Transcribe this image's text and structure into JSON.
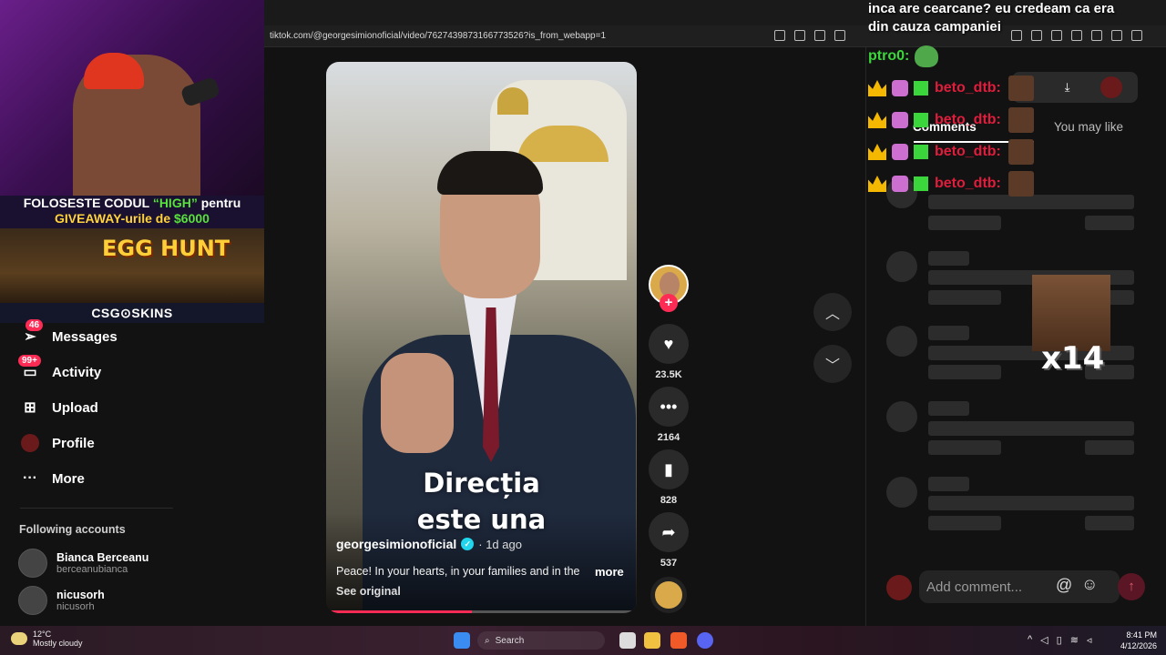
{
  "browser": {
    "url": "tiktok.com/@georgesimionoficial/video/7627439873166773526?is_from_webapp=1"
  },
  "stream_overlay": {
    "promo_line1_prefix": "FOLOSESTE CODUL ",
    "promo_code": "“HIGH”",
    "promo_line1_suffix": " pentru",
    "promo_line2_prefix": "GIVEAWAY-urile de ",
    "promo_amount": "$6000",
    "banner_title": "EGG HUNT",
    "sponsor": "CSG⊙SKINS"
  },
  "nav": {
    "items": [
      {
        "label": "Messages",
        "badge": "46",
        "icon": "paper-plane-icon"
      },
      {
        "label": "Activity",
        "badge": "99+",
        "icon": "message-icon"
      },
      {
        "label": "Upload",
        "badge": "",
        "icon": "plus-square-icon"
      },
      {
        "label": "Profile",
        "badge": "",
        "icon": "avatar-icon"
      },
      {
        "label": "More",
        "badge": "",
        "icon": "ellipsis-icon"
      }
    ],
    "following_title": "Following accounts",
    "following": [
      {
        "name": "Bianca Berceanu",
        "handle": "berceanubianca"
      },
      {
        "name": "nicusorh",
        "handle": "nicusorh"
      }
    ]
  },
  "video": {
    "caption_line1": "Direcția",
    "caption_line2": "este una",
    "author": "georgesimionoficial",
    "verified_mark": "✓",
    "age": "· 1d ago",
    "description": "Peace! In your hearts, in your families and in the",
    "more_label": "more",
    "see_original": "See original",
    "progress": 0.47
  },
  "actions": {
    "likes": "23.5K",
    "comments": "2164",
    "saves": "828",
    "shares": "537"
  },
  "comments_panel": {
    "tab_comments": "Comments",
    "tab_you_may_like": "You may like",
    "add_comment_placeholder": "Add comment...",
    "meme_text": "x14"
  },
  "chat": {
    "top_line1": "inca are cearcane? eu credeam ca era",
    "top_line2": "din cauza campaniei",
    "pepe_user": "ptro0:",
    "repeat_user": "beto_dtb:"
  },
  "taskbar": {
    "temp": "12°C",
    "weather": "Mostly cloudy",
    "search": "Search",
    "time": "8:41 PM",
    "date": "4/12/2026"
  },
  "colors": {
    "accent": "#fe2c55",
    "promo_green": "#58e13c",
    "chat_red": "#e01d3c",
    "chat_green": "#3bd63b"
  }
}
